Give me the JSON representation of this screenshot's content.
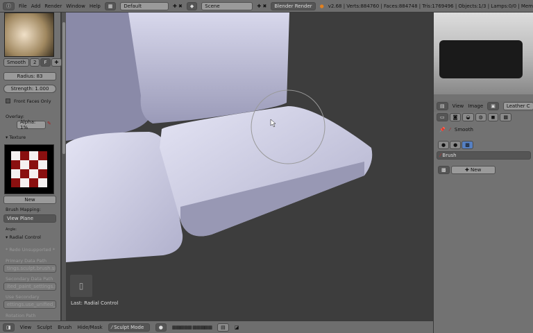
{
  "topbar": {
    "menus": [
      "File",
      "Add",
      "Render",
      "Window",
      "Help"
    ],
    "layout": "Default",
    "scene": "Scene",
    "engine": "Blender Render",
    "stats": "v2.68 | Verts:884760 | Faces:884748 | Tris:1769496 | Objects:1/3 | Lamps:0/0 | Mem"
  },
  "left": {
    "brush_name": "Smooth",
    "brush_users": "2",
    "fake_user": "F",
    "radius": "Radius: 83",
    "strength": "Strength: 1.000",
    "front_faces": "Front Faces Only",
    "overlay": "Overlay:",
    "alpha": "Alpha: 1%",
    "texture_header": "Texture",
    "new": "New",
    "brush_mapping": "Brush Mapping:",
    "mapping_value": "View Plane",
    "angle": "Angle:",
    "radial_header": "Radial Control",
    "radial_unsupported": "* Redo Unsupported *",
    "primary_label": "Primary Data Path",
    "primary_value": "tings.sculpt.brush.size",
    "secondary_label": "Secondary Data Path",
    "secondary_value": "ited_paint_settings.size",
    "use_secondary_label": "Use Secondary",
    "use_secondary_value": "ettings.use_unified_size",
    "rotation_label": "Rotation Path"
  },
  "viewport": {
    "last_op": "Last: Radial Control"
  },
  "bottombar": {
    "menus": [
      "View",
      "Sculpt",
      "Brush",
      "Hide/Mask"
    ],
    "mode": "Sculpt Mode"
  },
  "right": {
    "menus": [
      "View",
      "Image"
    ],
    "image_name": "Leather C",
    "brush_name": "Smooth",
    "texture_select": "Brush",
    "new": "New"
  }
}
